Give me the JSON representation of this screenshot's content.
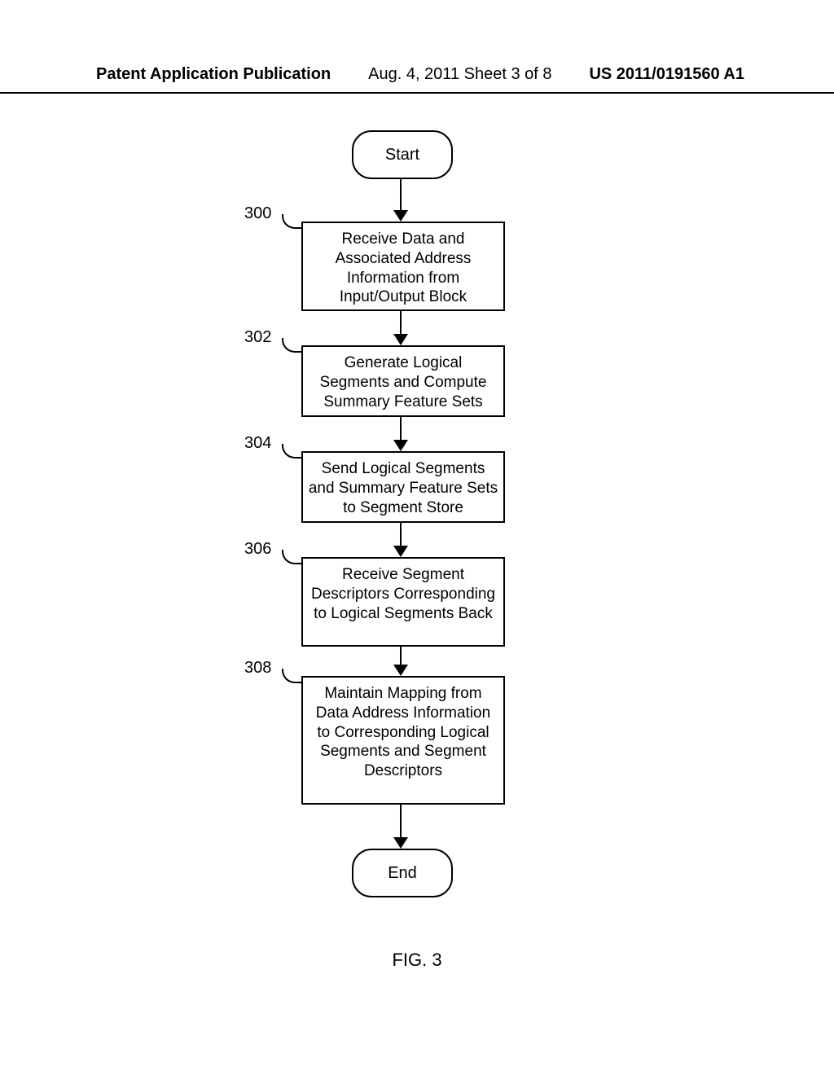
{
  "header": {
    "left": "Patent Application Publication",
    "mid": "Aug. 4, 2011  Sheet 3 of 8",
    "right": "US 2011/0191560 A1"
  },
  "flow": {
    "start": "Start",
    "end": "End",
    "steps": [
      {
        "ref": "300",
        "text": "Receive Data and Associated Address Information from Input/Output Block"
      },
      {
        "ref": "302",
        "text": "Generate Logical Segments and Compute Summary Feature Sets"
      },
      {
        "ref": "304",
        "text": "Send Logical Segments and Summary Feature Sets to Segment Store"
      },
      {
        "ref": "306",
        "text": "Receive Segment Descriptors Corresponding to Logical Segments Back"
      },
      {
        "ref": "308",
        "text": "Maintain Mapping from Data Address Information to Corresponding Logical Segments and Segment Descriptors"
      }
    ]
  },
  "figure_label": "FIG. 3"
}
